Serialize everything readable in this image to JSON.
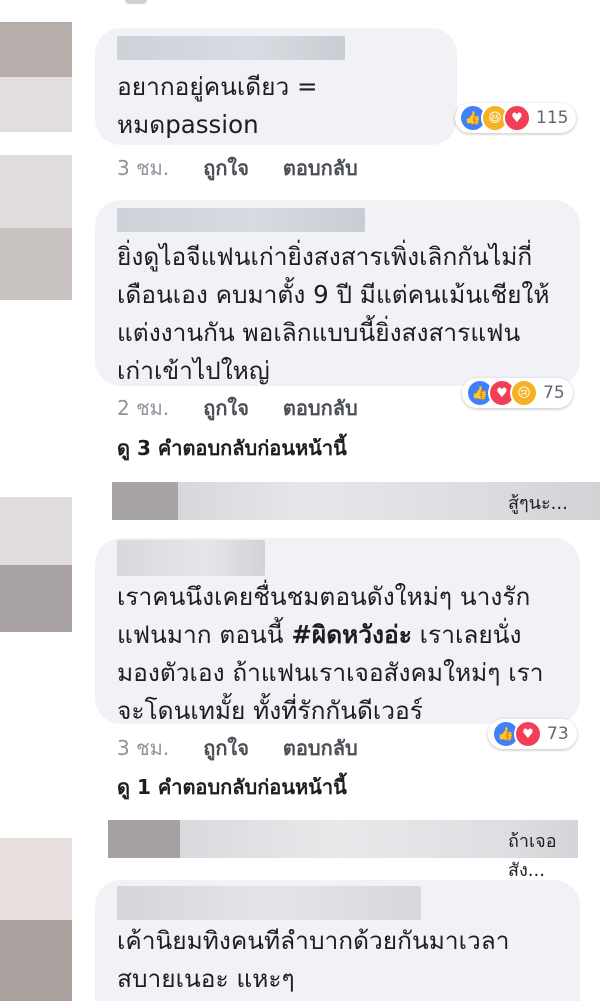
{
  "comments": [
    {
      "text": "อยากอยู่คนเดียว =\nหมดpassion",
      "time": "3 ชม.",
      "like_label": "ถูกใจ",
      "reply_label": "ตอบกลับ",
      "reaction_count": "115",
      "reactions": [
        "like-icon",
        "haha-icon",
        "love-icon"
      ]
    },
    {
      "text": "ยิ่งดูไอจีแฟนเก่ายิ่งสงสารเพิ่งเลิกกันไม่กี่\nเดือนเอง คบมาตั้ง 9 ปี มีแต่คนเม้นเชียให้\nแต่งงานกัน พอเลิกแบบนี้ยิ่งสงสารแฟน\nเก่าเข้าไปใหญ่",
      "time": "2 ชม.",
      "like_label": "ถูกใจ",
      "reply_label": "ตอบกลับ",
      "reaction_count": "75",
      "reactions": [
        "like-icon",
        "love-icon",
        "sad-icon"
      ],
      "more_replies": "ดู 3 คำตอบกลับก่อนหน้านี้",
      "reply_preview": "สู้ๆนะ..."
    },
    {
      "text_before": "เราคนนึงเคยชื่นชมตอนดังใหม่ๆ นางรัก\nแฟนมาก ตอนนี้ ",
      "hashtag": "#ผิดหวังอ่ะ",
      "text_after": " เราเลยนั่ง\nมองตัวเอง ถ้าแฟนเราเจอสังคมใหม่ๆ เรา\nจะโดนเทมั้ย ทั้งที่รักกันดีเวอร์",
      "time": "3 ชม.",
      "like_label": "ถูกใจ",
      "reply_label": "ตอบกลับ",
      "reaction_count": "73",
      "reactions": [
        "like-icon",
        "love-icon"
      ],
      "more_replies": "ดู 1 คำตอบกลับก่อนหน้านี้",
      "reply_preview": "ถ้าเจอสัง..."
    },
    {
      "text": "เค้านิยมทิงคนทีลำบากด้วยกันมาเวลา\nสบายเนอะ แหะๆ"
    }
  ],
  "colors": {
    "bubble": "#f1f2f6",
    "like": "#4080ff",
    "love": "#f33e58",
    "haha": "#f7b125"
  }
}
